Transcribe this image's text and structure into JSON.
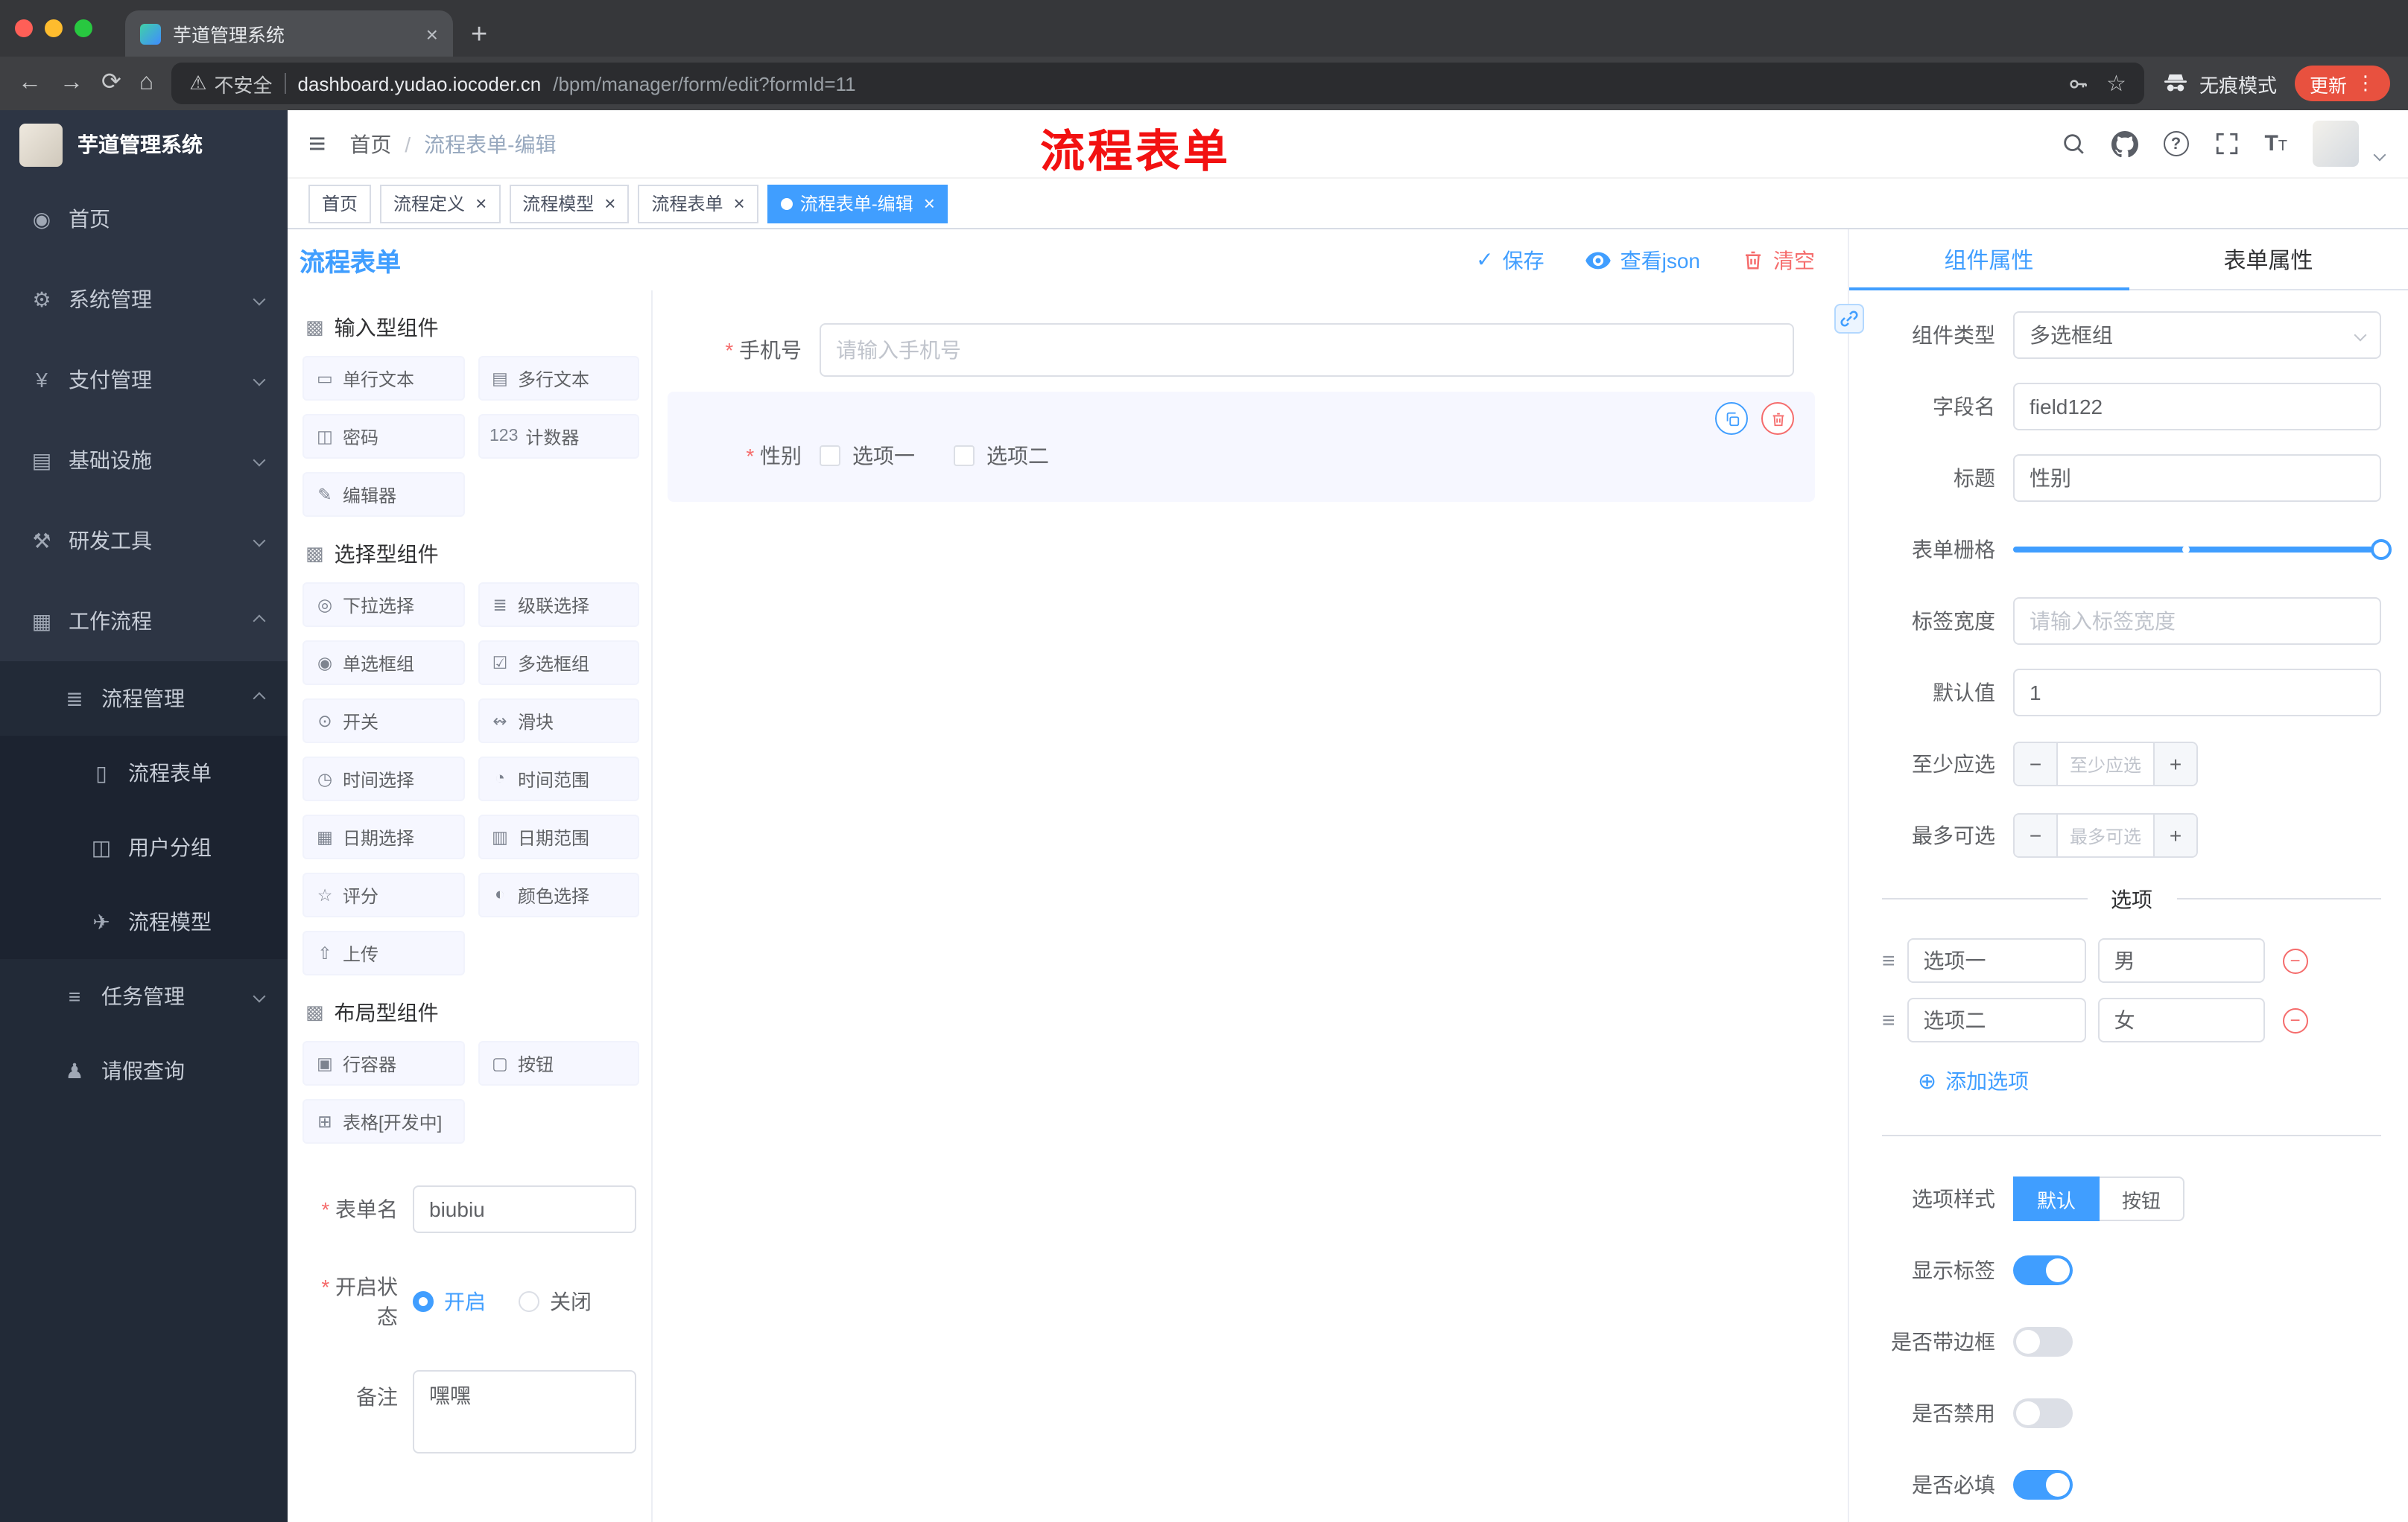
{
  "colors": {
    "accent": "#409EFF",
    "danger": "#F56C6C",
    "annotation": "#FF0000"
  },
  "browser": {
    "tab_title": "芋道管理系统",
    "security_label": "不安全",
    "url_host": "dashboard.yudao.iocoder.cn",
    "url_path": "/bpm/manager/form/edit?formId=11",
    "incognito_label": "无痕模式",
    "update_label": "更新"
  },
  "app_header": {
    "breadcrumb_home": "首页",
    "breadcrumb_separator": "/",
    "breadcrumb_current": "流程表单-编辑",
    "annotation": "流程表单"
  },
  "tags_view": [
    {
      "label": "首页",
      "closable": false,
      "active": false
    },
    {
      "label": "流程定义",
      "closable": true,
      "active": false
    },
    {
      "label": "流程模型",
      "closable": true,
      "active": false
    },
    {
      "label": "流程表单",
      "closable": true,
      "active": false
    },
    {
      "label": "流程表单-编辑",
      "closable": true,
      "active": true
    }
  ],
  "sidebar": {
    "logo_title": "芋道管理系统",
    "items": [
      {
        "label": "首页",
        "icon": "dashboard-icon",
        "depth": 0,
        "arrow": ""
      },
      {
        "label": "系统管理",
        "icon": "gear-icon",
        "depth": 0,
        "arrow": "down"
      },
      {
        "label": "支付管理",
        "icon": "yen-icon",
        "depth": 0,
        "arrow": "down"
      },
      {
        "label": "基础设施",
        "icon": "infrastructure-icon",
        "depth": 0,
        "arrow": "down"
      },
      {
        "label": "研发工具",
        "icon": "tools-icon",
        "depth": 0,
        "arrow": "down"
      },
      {
        "label": "工作流程",
        "icon": "workflow-icon",
        "depth": 0,
        "arrow": "up"
      },
      {
        "label": "流程管理",
        "icon": "process-icon",
        "depth": 1,
        "arrow": "up"
      },
      {
        "label": "流程表单",
        "icon": "form-icon",
        "depth": 2,
        "arrow": ""
      },
      {
        "label": "用户分组",
        "icon": "users-icon",
        "depth": 2,
        "arrow": ""
      },
      {
        "label": "流程模型",
        "icon": "model-icon",
        "depth": 2,
        "arrow": ""
      },
      {
        "label": "任务管理",
        "icon": "task-icon",
        "depth": 1,
        "arrow": "down"
      },
      {
        "label": "请假查询",
        "icon": "leave-icon",
        "depth": 1,
        "arrow": ""
      }
    ]
  },
  "designer": {
    "title": "流程表单",
    "actions": {
      "save": "保存",
      "view_json": "查看json",
      "clear": "清空"
    },
    "palette": {
      "sections": [
        {
          "title": "输入型组件",
          "items": [
            {
              "label": "单行文本",
              "icon": "single-line-icon"
            },
            {
              "label": "多行文本",
              "icon": "multi-line-icon"
            },
            {
              "label": "密码",
              "icon": "password-icon"
            },
            {
              "label": "计数器",
              "icon": "counter-icon"
            },
            {
              "label": "编辑器",
              "icon": "editor-icon"
            }
          ]
        },
        {
          "title": "选择型组件",
          "items": [
            {
              "label": "下拉选择",
              "icon": "select-icon"
            },
            {
              "label": "级联选择",
              "icon": "cascader-icon"
            },
            {
              "label": "单选框组",
              "icon": "radio-group-icon"
            },
            {
              "label": "多选框组",
              "icon": "checkbox-group-icon"
            },
            {
              "label": "开关",
              "icon": "switch-icon"
            },
            {
              "label": "滑块",
              "icon": "slider-icon"
            },
            {
              "label": "时间选择",
              "icon": "time-picker-icon"
            },
            {
              "label": "时间范围",
              "icon": "time-range-icon"
            },
            {
              "label": "日期选择",
              "icon": "date-picker-icon"
            },
            {
              "label": "日期范围",
              "icon": "date-range-icon"
            },
            {
              "label": "评分",
              "icon": "rate-icon"
            },
            {
              "label": "颜色选择",
              "icon": "color-picker-icon"
            },
            {
              "label": "上传",
              "icon": "upload-icon"
            }
          ]
        },
        {
          "title": "布局型组件",
          "items": [
            {
              "label": "行容器",
              "icon": "row-container-icon"
            },
            {
              "label": "按钮",
              "icon": "button-icon"
            },
            {
              "label": "表格[开发中]",
              "icon": "table-icon"
            }
          ]
        }
      ]
    },
    "form_meta": {
      "name_label": "表单名",
      "name_value": "biubiu",
      "status_label": "开启状态",
      "status_options": [
        {
          "label": "开启",
          "checked": true
        },
        {
          "label": "关闭",
          "checked": false
        }
      ],
      "remark_label": "备注",
      "remark_value": "嘿嘿"
    },
    "canvas": {
      "phone": {
        "label": "手机号",
        "placeholder": "请输入手机号",
        "required": true
      },
      "gender": {
        "label": "性别",
        "required": true,
        "options": [
          {
            "label": "选项一",
            "checked": false
          },
          {
            "label": "选项二",
            "checked": false
          }
        ]
      }
    },
    "properties": {
      "tabs": [
        {
          "label": "组件属性",
          "active": true
        },
        {
          "label": "表单属性",
          "active": false
        }
      ],
      "component_type": {
        "label": "组件类型",
        "value": "多选框组"
      },
      "field_name": {
        "label": "字段名",
        "value": "field122"
      },
      "title": {
        "label": "标题",
        "value": "性别"
      },
      "grid": {
        "label": "表单栅格"
      },
      "label_width": {
        "label": "标签宽度",
        "placeholder": "请输入标签宽度"
      },
      "default_value": {
        "label": "默认值",
        "value": "1"
      },
      "min_select": {
        "label": "至少应选",
        "placeholder": "至少应选"
      },
      "max_select": {
        "label": "最多可选",
        "placeholder": "最多可选"
      },
      "options_title": "选项",
      "options": [
        {
          "name": "选项一",
          "value": "男"
        },
        {
          "name": "选项二",
          "value": "女"
        }
      ],
      "add_option": "添加选项",
      "option_style": {
        "label": "选项样式",
        "choices": [
          {
            "label": "默认",
            "active": true
          },
          {
            "label": "按钮",
            "active": false
          }
        ]
      },
      "switches": [
        {
          "label": "显示标签",
          "on": true
        },
        {
          "label": "是否带边框",
          "on": false
        },
        {
          "label": "是否禁用",
          "on": false
        },
        {
          "label": "是否必填",
          "on": true
        }
      ]
    }
  }
}
